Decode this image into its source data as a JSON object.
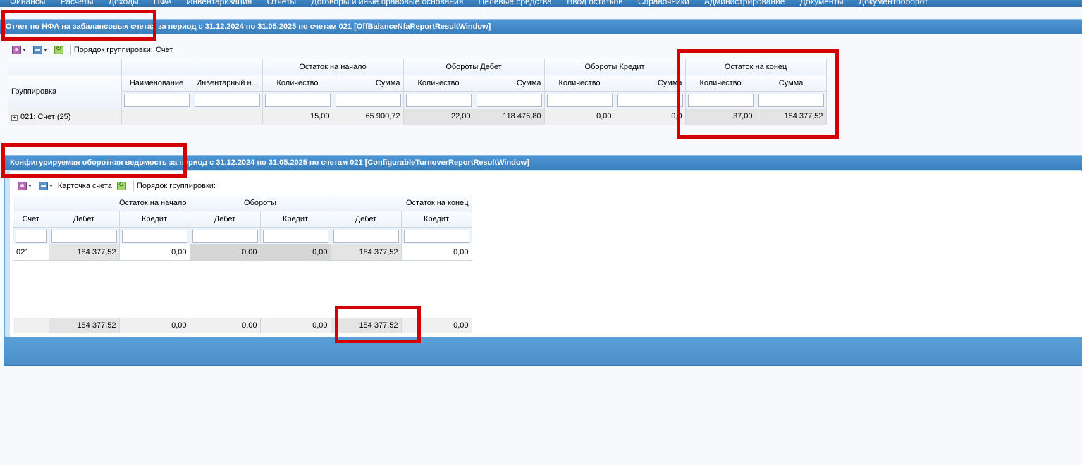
{
  "menu": [
    "Финансы",
    "Расчеты",
    "Доходы",
    "НФА",
    "Инвентаризация",
    "Отчеты",
    "Договоры и иные правовые основания",
    "Целевые средства",
    "Ввод остатков",
    "Справочники",
    "Администрирование",
    "Документы",
    "Документооборот"
  ],
  "report1": {
    "title": "Отчет по НФА на забалансовых счетах за период с 31.12.2024 по 31.05.2025 по счетам 021 [OffBalanceNfaReportResultWindow]",
    "toolbar": {
      "grouping_label": "Порядок группировки:",
      "grouping_value": "Счет"
    },
    "headers": {
      "grouping": "Группировка",
      "name": "Наименование",
      "inventory": "Инвентарный н...",
      "start": "Остаток на начало",
      "debit_turnover": "Обороты Дебет",
      "credit_turnover": "Обороты Кредит",
      "end": "Остаток на конец",
      "qty": "Количество",
      "sum": "Сумма"
    },
    "row": {
      "group": "021: Счет (25)",
      "start_qty": "15,00",
      "start_sum": "65 900,72",
      "deb_qty": "22,00",
      "deb_sum": "118 476,80",
      "cred_qty": "0,00",
      "cred_sum": "0,0",
      "end_qty": "37,00",
      "end_sum": "184 377,52"
    }
  },
  "report2": {
    "title": "Конфигурируемая оборотная ведомость за период с 31.12.2024 по 31.05.2025 по счетам 021 [ConfigurableTurnoverReportResultWindow]",
    "toolbar": {
      "card_label": "Карточка счета",
      "grouping_label": "Порядок группировки:"
    },
    "headers": {
      "account": "Счет",
      "start": "Остаток на начало",
      "turnover": "Обороты",
      "end": "Остаток на конец",
      "debit": "Дебет",
      "credit": "Кредит"
    },
    "row": {
      "account": "021",
      "start_debit": "184 377,52",
      "start_credit": "0,00",
      "turn_debit": "0,00",
      "turn_credit": "0,00",
      "end_debit": "184 377,52",
      "end_credit": "0,00"
    },
    "totals": {
      "start_debit": "184 377,52",
      "start_credit": "0,00",
      "turn_debit": "0,00",
      "turn_credit": "0,00",
      "end_debit": "184 377,52",
      "end_credit": "0,00"
    }
  },
  "colors": {
    "title_bar": "#3b7fbd",
    "highlight": "#d40000",
    "header_bg": "#edf3fa"
  }
}
